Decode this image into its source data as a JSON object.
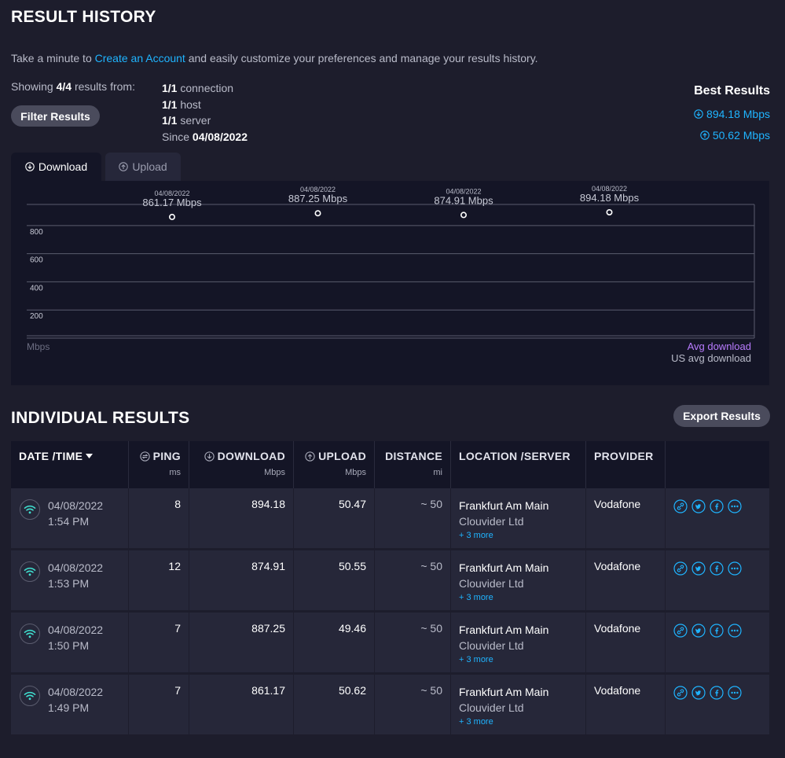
{
  "header": {
    "title": "RESULT HISTORY",
    "intro_prefix": "Take a minute to ",
    "intro_link": "Create an Account",
    "intro_suffix": " and easily customize your preferences and manage your results history."
  },
  "summary": {
    "showing_prefix": "Showing ",
    "showing_count": "4/4",
    "showing_suffix": " results from:",
    "filter_button": "Filter Results",
    "details": [
      {
        "value": "1/1",
        "label": " connection"
      },
      {
        "value": "1/1",
        "label": " host"
      },
      {
        "value": "1/1",
        "label": " server"
      },
      {
        "value": "04/08/2022",
        "label": "Since ",
        "prefix": true
      }
    ]
  },
  "best_results": {
    "title": "Best Results",
    "download": "894.18 Mbps",
    "upload": "50.62 Mbps"
  },
  "tabs": [
    {
      "label": "Download",
      "icon": "download-circle-icon",
      "active": true
    },
    {
      "label": "Upload",
      "icon": "upload-circle-icon",
      "active": false
    }
  ],
  "chart_data": {
    "type": "scatter",
    "unit_label": "Mbps",
    "ylim": [
      0,
      950
    ],
    "yticks": [
      200,
      400,
      600,
      800
    ],
    "points": [
      {
        "date": "04/08/2022",
        "label": "861.17 Mbps",
        "value": 861.17
      },
      {
        "date": "04/08/2022",
        "label": "887.25 Mbps",
        "value": 887.25
      },
      {
        "date": "04/08/2022",
        "label": "874.91 Mbps",
        "value": 874.91
      },
      {
        "date": "04/08/2022",
        "label": "894.18 Mbps",
        "value": 894.18
      }
    ],
    "legend": {
      "avg": "Avg download",
      "us_avg": "US avg download"
    },
    "legend_colors": {
      "avg": "#b97cff",
      "us_avg": "#b9bbc9"
    },
    "grid": true
  },
  "individual": {
    "title": "INDIVIDUAL RESULTS",
    "export_button": "Export Results",
    "columns": {
      "date": "DATE /TIME",
      "ping": "PING",
      "ping_unit": "ms",
      "download": "DOWNLOAD",
      "download_unit": "Mbps",
      "upload": "UPLOAD",
      "upload_unit": "Mbps",
      "distance": "DISTANCE",
      "distance_unit": "mi",
      "location": "LOCATION /SERVER",
      "provider": "PROVIDER"
    },
    "rows": [
      {
        "date": "04/08/2022",
        "time": "1:54 PM",
        "ping": "8",
        "download": "894.18",
        "upload": "50.47",
        "distance": "~ 50",
        "location": "Frankfurt Am Main",
        "server": "Clouvider Ltd",
        "more": "+ 3 more",
        "provider": "Vodafone"
      },
      {
        "date": "04/08/2022",
        "time": "1:53 PM",
        "ping": "12",
        "download": "874.91",
        "upload": "50.55",
        "distance": "~ 50",
        "location": "Frankfurt Am Main",
        "server": "Clouvider Ltd",
        "more": "+ 3 more",
        "provider": "Vodafone"
      },
      {
        "date": "04/08/2022",
        "time": "1:50 PM",
        "ping": "7",
        "download": "887.25",
        "upload": "49.46",
        "distance": "~ 50",
        "location": "Frankfurt Am Main",
        "server": "Clouvider Ltd",
        "more": "+ 3 more",
        "provider": "Vodafone"
      },
      {
        "date": "04/08/2022",
        "time": "1:49 PM",
        "ping": "7",
        "download": "861.17",
        "upload": "50.62",
        "distance": "~ 50",
        "location": "Frankfurt Am Main",
        "server": "Clouvider Ltd",
        "more": "+ 3 more",
        "provider": "Vodafone"
      }
    ],
    "row_icons": [
      "link-icon",
      "twitter-icon",
      "facebook-icon",
      "more-icon"
    ]
  },
  "colors": {
    "accent": "#1fb4ff",
    "background": "#1d1d2c",
    "panel": "#141526",
    "row": "#262739",
    "wifi": "#3fe0d0"
  }
}
